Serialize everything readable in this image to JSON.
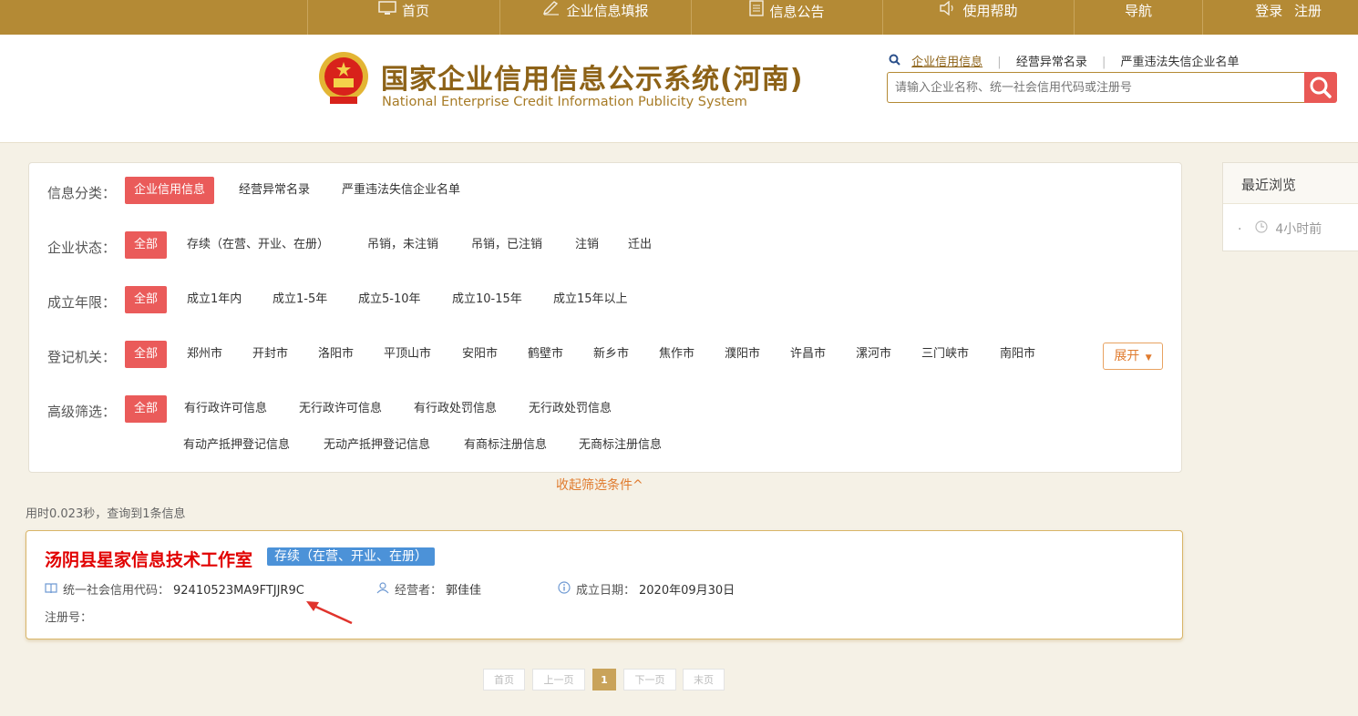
{
  "topnav": {
    "items": [
      {
        "label": "首页",
        "icon": "monitor-icon"
      },
      {
        "label": "企业信息填报",
        "icon": "edit-icon"
      },
      {
        "label": "信息公告",
        "icon": "document-icon"
      },
      {
        "label": "使用帮助",
        "icon": "speaker-icon"
      },
      {
        "label": "导航",
        "icon": ""
      }
    ],
    "login": "登录",
    "register": "注册"
  },
  "header": {
    "title": "国家企业信用信息公示系统(河南)",
    "subtitle": "National Enterprise Credit Information Publicity System",
    "search_tabs": [
      "企业信用信息",
      "经营异常名录",
      "严重违法失信企业名单"
    ],
    "search_placeholder": "请输入企业名称、统一社会信用代码或注册号"
  },
  "filters": {
    "category": {
      "label": "信息分类：",
      "options": [
        "企业信用信息",
        "经营异常名录",
        "严重违法失信企业名单"
      ]
    },
    "status": {
      "label": "企业状态：",
      "options": [
        "全部",
        "存续（在营、开业、在册）",
        "吊销，未注销",
        "吊销，已注销",
        "注销",
        "迁出"
      ]
    },
    "years": {
      "label": "成立年限：",
      "options": [
        "全部",
        "成立1年内",
        "成立1-5年",
        "成立5-10年",
        "成立10-15年",
        "成立15年以上"
      ]
    },
    "authority": {
      "label": "登记机关：",
      "options": [
        "全部",
        "郑州市",
        "开封市",
        "洛阳市",
        "平顶山市",
        "安阳市",
        "鹤壁市",
        "新乡市",
        "焦作市",
        "濮阳市",
        "许昌市",
        "漯河市",
        "三门峡市",
        "南阳市"
      ]
    },
    "advanced": {
      "label": "高级筛选：",
      "options": [
        "全部",
        "有行政许可信息",
        "无行政许可信息",
        "有行政处罚信息",
        "无行政处罚信息",
        "有动产抵押登记信息",
        "无动产抵押登记信息",
        "有商标注册信息",
        "无商标注册信息"
      ]
    },
    "expand_label": "展开",
    "collapse_label": "收起筛选条件^"
  },
  "recent": {
    "title": "最近浏览",
    "item": "4小时前"
  },
  "result": {
    "stats": "用时0.023秒，查询到1条信息",
    "company_name": "汤阴县星家信息技术工作室",
    "status": "存续（在营、开业、在册）",
    "credit_code_label": "统一社会信用代码：",
    "credit_code": "92410523MA9FTJJR9C",
    "operator_label": "经营者：",
    "operator": "郭佳佳",
    "date_label": "成立日期：",
    "date": "2020年09月30日",
    "reg_no_label": "注册号："
  },
  "pager": {
    "first": "首页",
    "prev": "上一页",
    "current": "1",
    "next": "下一页",
    "last": "末页"
  },
  "colors": {
    "brand": "#b48a35",
    "accent_red": "#ea5b5a",
    "name_red": "#e10000",
    "status_blue": "#4c92d8"
  }
}
